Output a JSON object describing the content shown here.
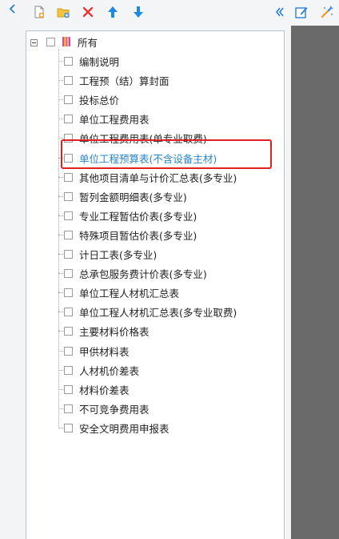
{
  "toolbar": {
    "icons": [
      "new-file-icon",
      "new-folder-icon",
      "delete-icon",
      "move-up-icon",
      "move-down-icon"
    ],
    "right_icons": [
      "collapse-panel-icon",
      "edit-icon",
      "settings-icon"
    ]
  },
  "tree": {
    "root_label": "所有",
    "items": [
      {
        "label": "编制说明",
        "checked": false,
        "active": false
      },
      {
        "label": "工程预（结）算封面",
        "checked": false,
        "active": false
      },
      {
        "label": "投标总价",
        "checked": false,
        "active": false
      },
      {
        "label": "单位工程费用表",
        "checked": false,
        "active": false
      },
      {
        "label": "单位工程费用表(单专业取费)",
        "checked": false,
        "active": false
      },
      {
        "label": "单位工程预算表(不含设备主材)",
        "checked": false,
        "active": true
      },
      {
        "label": "其他项目清单与计价汇总表(多专业)",
        "checked": false,
        "active": false
      },
      {
        "label": "暂列金额明细表(多专业)",
        "checked": false,
        "active": false
      },
      {
        "label": "专业工程暂估价表(多专业)",
        "checked": false,
        "active": false
      },
      {
        "label": "特殊项目暂估价表(多专业)",
        "checked": false,
        "active": false
      },
      {
        "label": "计日工表(多专业)",
        "checked": false,
        "active": false
      },
      {
        "label": "总承包服务费计价表(多专业)",
        "checked": false,
        "active": false
      },
      {
        "label": "单位工程人材机汇总表",
        "checked": false,
        "active": false
      },
      {
        "label": "单位工程人材机汇总表(多专业取费)",
        "checked": false,
        "active": false
      },
      {
        "label": "主要材料价格表",
        "checked": false,
        "active": false
      },
      {
        "label": "甲供材料表",
        "checked": false,
        "active": false
      },
      {
        "label": "人材机价差表",
        "checked": false,
        "active": false
      },
      {
        "label": "材料价差表",
        "checked": false,
        "active": false
      },
      {
        "label": "不可竞争费用表",
        "checked": false,
        "active": false
      },
      {
        "label": "安全文明费用申报表",
        "checked": false,
        "active": false
      }
    ]
  },
  "colors": {
    "accent": "#2b7fd8",
    "delete": "#e53935",
    "active_text": "#2a86c8",
    "highlight_border": "#e02020",
    "dark_panel": "#6a6a6a"
  }
}
